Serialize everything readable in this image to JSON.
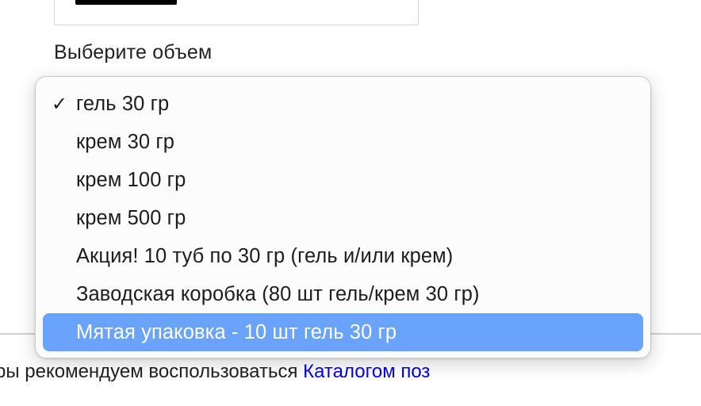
{
  "form": {
    "select_label": "Выберите объем"
  },
  "dropdown": {
    "selected_check": "✓",
    "options": [
      {
        "label": "гель 30 гр",
        "selected": true
      },
      {
        "label": "крем 30 гр",
        "selected": false
      },
      {
        "label": "крем 100 гр",
        "selected": false
      },
      {
        "label": "крем 500 гр",
        "selected": false
      },
      {
        "label": "Акция! 10 туб по 30 гр (гель и/или крем)",
        "selected": false
      },
      {
        "label": "Заводская коробка (80 шт гель/крем 30 гр)",
        "selected": false
      },
      {
        "label": "Мятая упаковка - 10 шт гель 30 гр",
        "selected": false,
        "highlighted": true
      }
    ],
    "highlight_color": "#6aa3fb"
  },
  "footer": {
    "text": "ры рекомендуем воспользоваться ",
    "link_text": "Каталогом поз"
  }
}
